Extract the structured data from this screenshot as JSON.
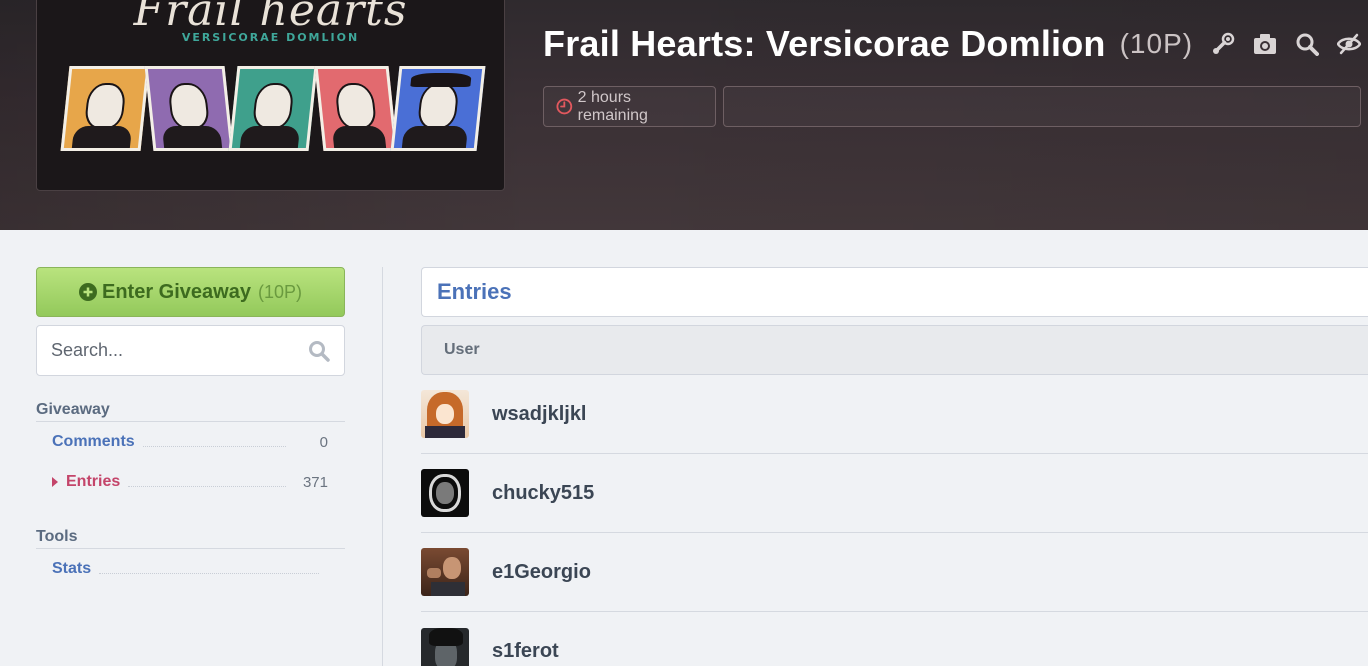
{
  "game": {
    "logo_title": "Frail hearts",
    "logo_subtitle": "VERSICORAE DOMLION",
    "title": "Frail Hearts: Versicorae Domlion",
    "points": "(10P)",
    "header_icons": [
      "steam-icon",
      "camera-icon",
      "search-icon",
      "hide-icon"
    ],
    "time_remaining": "2 hours remaining"
  },
  "sidebar": {
    "enter_button": {
      "label": "Enter Giveaway",
      "points": "(10P)"
    },
    "search": {
      "placeholder": "Search...",
      "value": ""
    },
    "giveaway_heading": "Giveaway",
    "giveaway_items": [
      {
        "label": "Comments",
        "count": "0"
      },
      {
        "label": "Entries",
        "count": "371"
      }
    ],
    "tools_heading": "Tools",
    "tools_items": [
      {
        "label": "Stats"
      }
    ]
  },
  "main": {
    "heading": "Entries",
    "column_header": "User",
    "rows": [
      {
        "username": "wsadjkljkl"
      },
      {
        "username": "chucky515"
      },
      {
        "username": "e1Georgio"
      },
      {
        "username": "s1ferot"
      }
    ]
  },
  "colors": {
    "accent_link": "#4b72b8",
    "active_link": "#c4456a",
    "enter_button": "#93c95b",
    "clock": "#e2585e"
  }
}
